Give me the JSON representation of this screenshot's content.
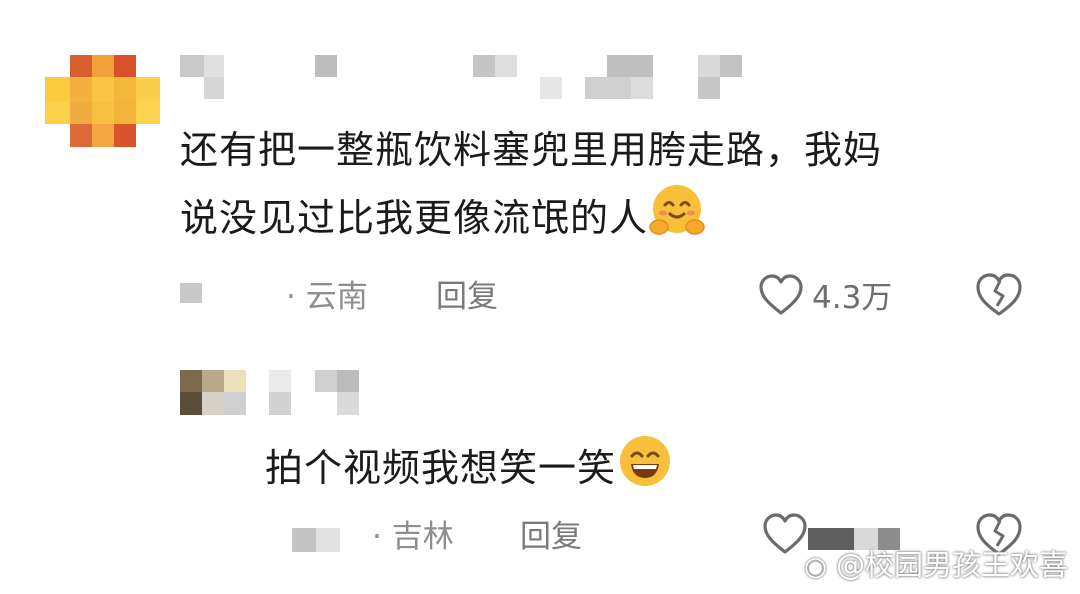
{
  "comments": [
    {
      "text_line1": "还有把一整瓶饮料塞兜里用胯走路，我妈",
      "text_line2": "说没见过比我更像流氓的人",
      "location": "· 云南",
      "reply_label": "回复",
      "likes": "4.3万"
    },
    {
      "text": "拍个视频我想笑一笑",
      "location": "· 吉林",
      "reply_label": "回复"
    }
  ],
  "watermark": "@校园男孩王欢喜",
  "icons": {
    "like": "heart-outline-icon",
    "dislike": "broken-heart-icon",
    "emoji1": "hugging-face-emoji",
    "emoji2": "grinning-face-emoji"
  },
  "colors": {
    "emoji_yellow": "#f7b733",
    "avatar_orange": "#f5a623",
    "avatar_red": "#d9542b"
  }
}
